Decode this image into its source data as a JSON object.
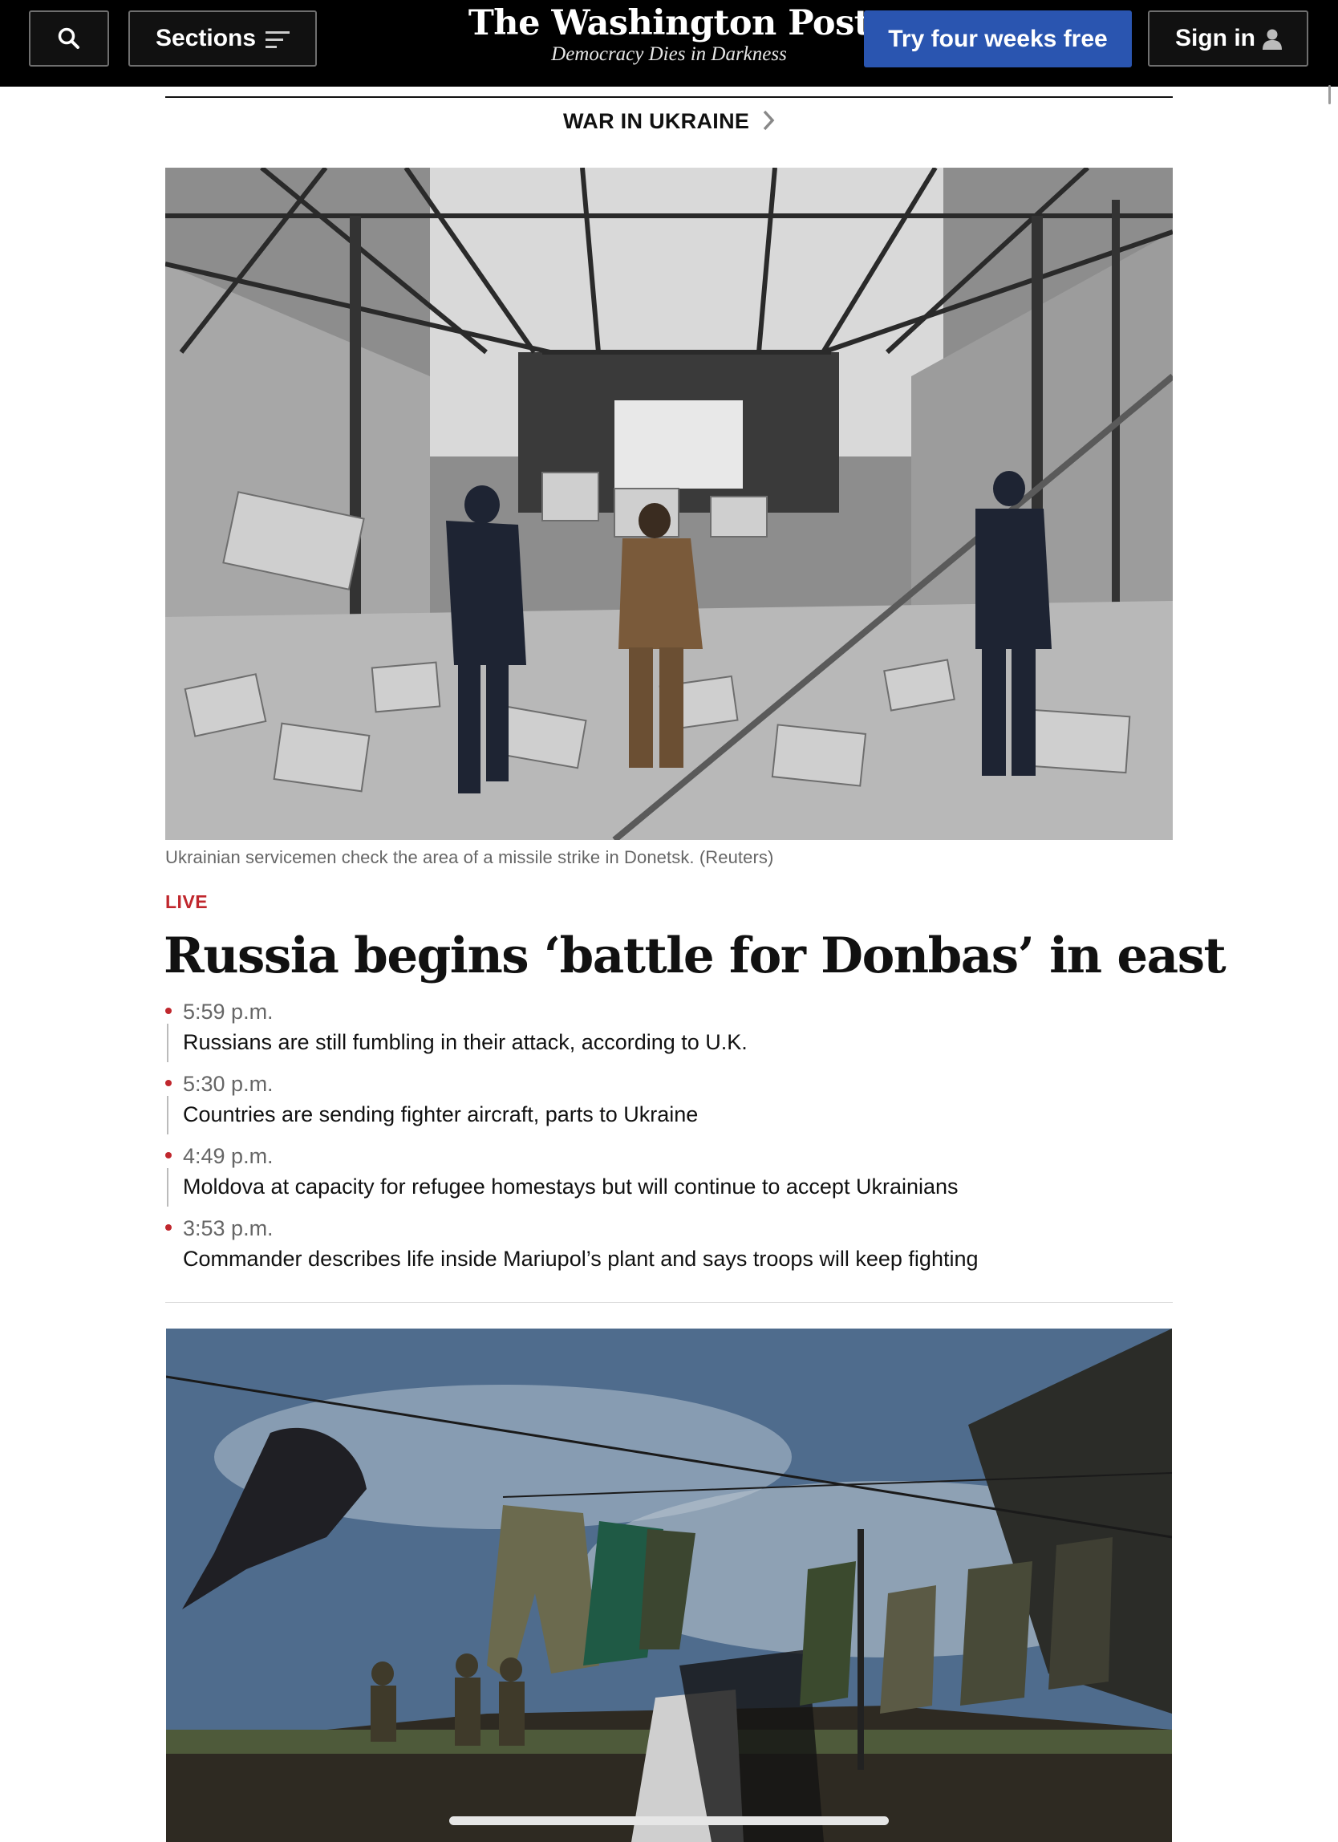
{
  "header": {
    "search_icon": "search-icon",
    "sections_label": "Sections",
    "logo": "The Washington Post",
    "tagline": "Democracy Dies in Darkness",
    "subscribe_label": "Try four weeks free",
    "signin_label": "Sign in"
  },
  "kicker": {
    "label": "WAR IN UKRAINE"
  },
  "lead": {
    "photo_caption": "Ukrainian servicemen check the area of a missile strike in Donetsk. (Reuters)",
    "live_label": "LIVE",
    "headline": "Russia begins ‘battle for Donbas’ in east"
  },
  "updates": [
    {
      "time": "5:59 p.m.",
      "title": "Russians are still fumbling in their attack, according to U.K."
    },
    {
      "time": "5:30 p.m.",
      "title": "Countries are sending fighter aircraft, parts to Ukraine"
    },
    {
      "time": "4:49 p.m.",
      "title": "Moldova at capacity for refugee homestays but will continue to accept Ukrainians"
    },
    {
      "time": "3:53 p.m.",
      "title": "Commander describes life inside Mariupol’s plant and says troops will keep fighting"
    }
  ],
  "colors": {
    "topbar": "#000000",
    "subscribe_button": "#2a55b0",
    "live_red": "#c0272d"
  }
}
